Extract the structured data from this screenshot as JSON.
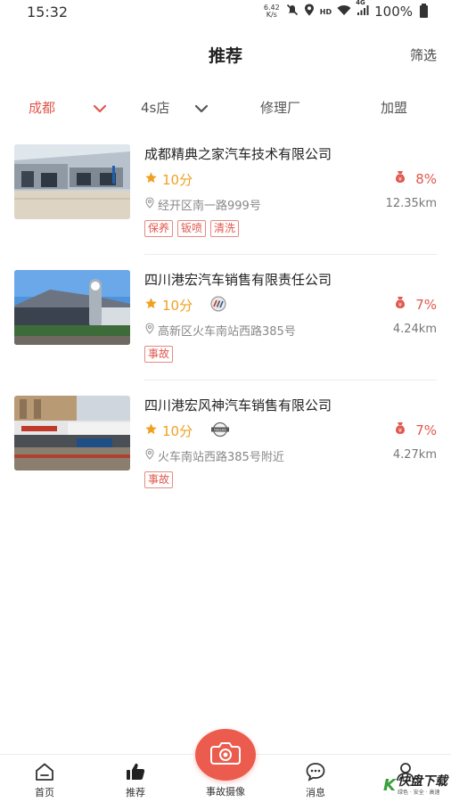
{
  "status_bar": {
    "time": "15:32",
    "net_speed_value": "6.42",
    "net_speed_unit": "K/s",
    "hd_label": "HD",
    "signal_label": "4G",
    "battery": "100%"
  },
  "header": {
    "title": "推荐",
    "filter_label": "筛选"
  },
  "filters": {
    "city": "成都",
    "type": "4s店",
    "repair": "修理厂",
    "franchise": "加盟"
  },
  "shops": [
    {
      "name": "成都精典之家汽车技术有限公司",
      "rating": "10分",
      "commission": "8%",
      "address": "经开区南一路999号",
      "distance": "12.35km",
      "tags": [
        "保养",
        "钣喷",
        "清洗"
      ],
      "brand_icon": "none"
    },
    {
      "name": "四川港宏汽车销售有限责任公司",
      "rating": "10分",
      "commission": "7%",
      "address": "高新区火车南站西路385号",
      "distance": "4.24km",
      "tags": [
        "事故"
      ],
      "brand_icon": "buick-logo-icon"
    },
    {
      "name": "四川港宏风神汽车销售有限公司",
      "rating": "10分",
      "commission": "7%",
      "address": "火车南站西路385号附近",
      "distance": "4.27km",
      "tags": [
        "事故"
      ],
      "brand_icon": "nissan-logo-icon",
      "brand_text": "NISSAN"
    }
  ],
  "bottom_nav": {
    "home": "首页",
    "recommend": "推荐",
    "camera": "事故摄像",
    "messages": "消息",
    "profile": "我的"
  },
  "watermark": {
    "logo": "K",
    "text": "快盘下载",
    "sub": "绿色 · 安全 · 高速"
  },
  "colors": {
    "accent": "#e0584e",
    "star": "#f0a020",
    "fab": "#ec5c4e"
  }
}
